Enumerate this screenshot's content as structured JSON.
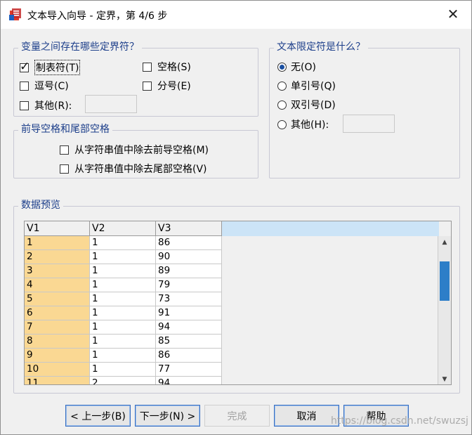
{
  "window": {
    "title": "文本导入向导 - 定界，第 4/6 步",
    "app_icon": "spss-app-icon",
    "close_icon": "close-icon",
    "close_glyph": "✕"
  },
  "delimiters": {
    "title": "变量之间存在哪些定界符？",
    "options": [
      {
        "label": "制表符(T)",
        "checked": true
      },
      {
        "label": "空格(S)",
        "checked": false
      },
      {
        "label": "逗号(C)",
        "checked": false
      },
      {
        "label": "分号(E)",
        "checked": false
      },
      {
        "label": "其他(R):",
        "checked": false
      }
    ],
    "other_value": ""
  },
  "qualifier": {
    "title": "文本限定符是什么？",
    "options": [
      {
        "label": "无(O)",
        "selected": true
      },
      {
        "label": "单引号(Q)",
        "selected": false
      },
      {
        "label": "双引号(D)",
        "selected": false
      },
      {
        "label": "其他(H):",
        "selected": false
      }
    ],
    "other_value": ""
  },
  "spaces": {
    "title": "前导空格和尾部空格",
    "options": [
      {
        "label": "从字符串值中除去前导空格(M)",
        "checked": false
      },
      {
        "label": "从字符串值中除去尾部空格(V)",
        "checked": false
      }
    ]
  },
  "preview": {
    "title": "数据预览",
    "columns": [
      "V1",
      "V2",
      "V3"
    ],
    "rows": [
      [
        "1",
        "1",
        "86"
      ],
      [
        "2",
        "1",
        "90"
      ],
      [
        "3",
        "1",
        "89"
      ],
      [
        "4",
        "1",
        "79"
      ],
      [
        "5",
        "1",
        "73"
      ],
      [
        "6",
        "1",
        "91"
      ],
      [
        "7",
        "1",
        "94"
      ],
      [
        "8",
        "1",
        "85"
      ],
      [
        "9",
        "1",
        "86"
      ],
      [
        "10",
        "1",
        "77"
      ],
      [
        "11",
        "2",
        "94"
      ]
    ],
    "highlight_color": "#fad893"
  },
  "buttons": {
    "back": "< 上一步(B)",
    "next": "下一步(N) >",
    "finish": "完成",
    "cancel": "取消",
    "help": "帮助"
  },
  "watermark": "https://blog.csdn.net/swuzsj"
}
